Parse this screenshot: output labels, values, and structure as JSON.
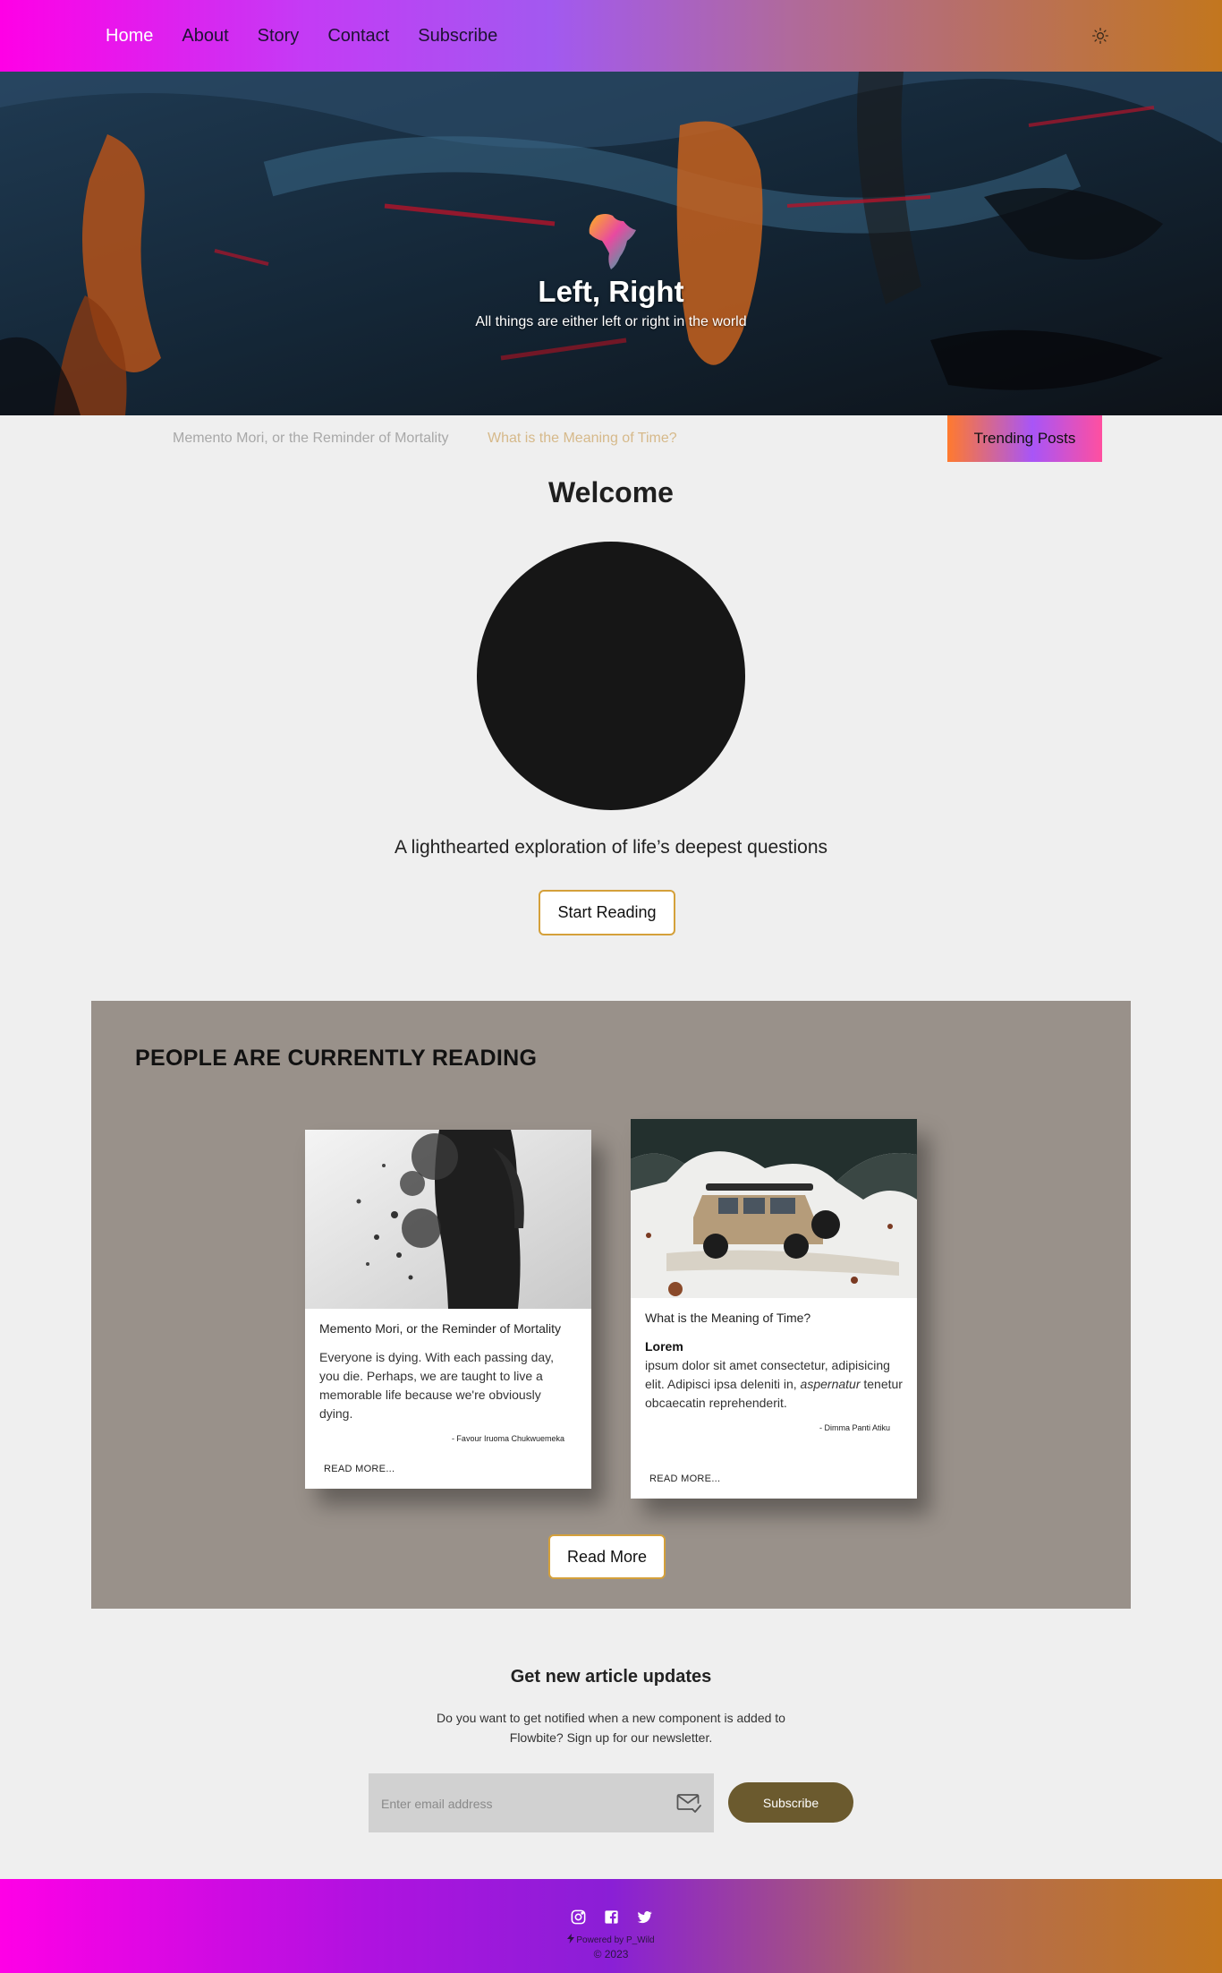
{
  "nav": {
    "items": [
      {
        "label": "Home",
        "active": true
      },
      {
        "label": "About"
      },
      {
        "label": "Story"
      },
      {
        "label": "Contact"
      },
      {
        "label": "Subscribe"
      }
    ],
    "theme_icon": "sun-icon"
  },
  "hero": {
    "logo_icon": "africa-logo-icon",
    "title": "Left, Right",
    "subtitle": "All things are either left or right in the world"
  },
  "ticker": {
    "items": [
      "Memento Mori, or the Reminder of Mortality",
      "What is the Meaning of Time?"
    ],
    "trending_label": "Trending Posts"
  },
  "welcome": {
    "title": "Welcome",
    "tagline": "A lighthearted exploration of life’s deepest questions",
    "start_label": "Start Reading"
  },
  "reading": {
    "title": "PEOPLE ARE CURRENTLY READING",
    "cards": [
      {
        "title": "Memento Mori, or the Reminder of Mortality",
        "text": "Everyone is dying. With each passing day, you die. Perhaps, we are taught to live a memorable life because we're obviously dying.",
        "author": "- Favour Iruoma Chukwuemeka",
        "more": "READ MORE..."
      },
      {
        "title": "What is the Meaning of Time?",
        "heading": "Lorem",
        "text_before": "ipsum dolor sit amet consectetur, adipisicing elit. Adipisci ipsa deleniti in, ",
        "text_italic": "aspernatur",
        "text_after": " tenetur obcaecatin reprehenderit.",
        "author": "- Dimma Panti Atiku",
        "more": "READ MORE..."
      }
    ],
    "read_more_label": "Read More"
  },
  "newsletter": {
    "title": "Get new article updates",
    "text": "Do you want to get notified when a new component is added to Flowbite? Sign up for our newsletter.",
    "placeholder": "Enter email address",
    "subscribe_label": "Subscribe"
  },
  "footer": {
    "socials": [
      "instagram-icon",
      "facebook-icon",
      "twitter-icon"
    ],
    "powered": "Powered by P_Wild",
    "copyright": "© 2023"
  }
}
